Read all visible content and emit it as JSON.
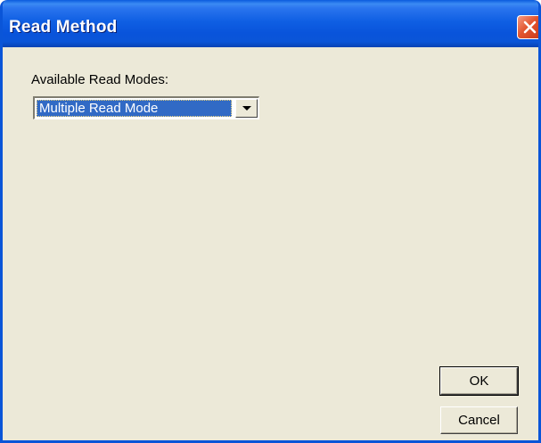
{
  "window": {
    "title": "Read Method"
  },
  "form": {
    "modes_label": "Available Read Modes:",
    "modes_selected": "Multiple Read Mode"
  },
  "buttons": {
    "ok_label": "OK",
    "cancel_label": "Cancel"
  },
  "icons": {
    "close": "close-icon",
    "dropdown": "chevron-down-icon"
  },
  "colors": {
    "titlebar": "#0A55D8",
    "dialog_background": "#ECE9D8",
    "selection": "#316AC5",
    "close_button": "#E2552F"
  }
}
